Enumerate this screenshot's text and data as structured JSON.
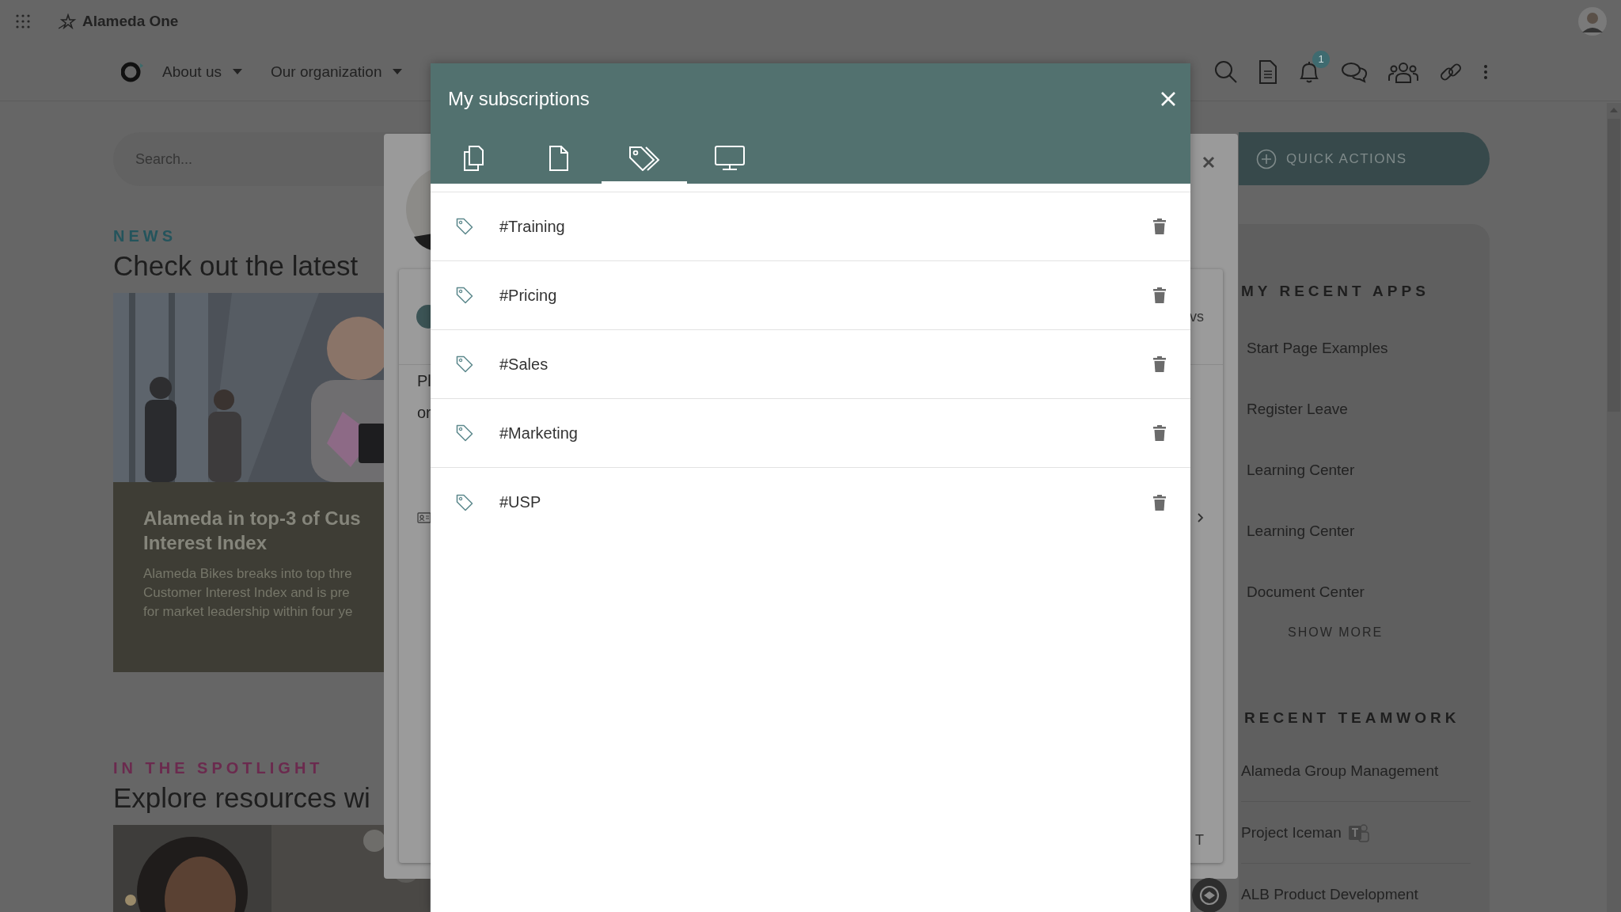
{
  "app_bar": {
    "title": "Alameda One"
  },
  "nav": {
    "items": [
      {
        "label": "About us"
      },
      {
        "label": "Our organization"
      }
    ],
    "notification_count": "1"
  },
  "search": {
    "placeholder": "Search..."
  },
  "quick_actions": {
    "label": "QUICK ACTIONS"
  },
  "news": {
    "eyebrow": "NEWS",
    "heading": "Check out the latest",
    "card": {
      "title_lines": [
        "Alameda in top-3 of Cus",
        "Interest Index"
      ],
      "text_lines": [
        "Alameda Bikes breaks into top thre",
        "Customer Interest Index and is pre",
        "for market leadership within four ye"
      ]
    }
  },
  "spotlight": {
    "eyebrow": "IN THE SPOTLIGHT",
    "heading": "Explore resources wi"
  },
  "recent_apps": {
    "title": "MY RECENT APPS",
    "items": [
      {
        "name": "Start Page Examples"
      },
      {
        "name": "Register Leave"
      },
      {
        "name": "Learning Center"
      },
      {
        "name": "Learning Center"
      },
      {
        "name": "Document Center"
      }
    ],
    "more": "SHOW MORE"
  },
  "recent_teamwork": {
    "title": "RECENT TEAMWORK",
    "items": [
      {
        "name": "Alameda Group Management",
        "kind": "plain"
      },
      {
        "name": "Project Iceman",
        "kind": "teams"
      },
      {
        "name": "ALB Product Development",
        "kind": "product"
      }
    ]
  },
  "background_dialog": {
    "header_text": "vs",
    "body_lines": [
      "Pl",
      "or"
    ],
    "footer_text": "T"
  },
  "dialog": {
    "title": "My subscriptions",
    "tabs": [
      {
        "kind": "copies",
        "selected": false
      },
      {
        "kind": "document",
        "selected": false
      },
      {
        "kind": "tags",
        "selected": true
      },
      {
        "kind": "screen",
        "selected": false
      }
    ],
    "subscriptions": [
      {
        "name": "#Training"
      },
      {
        "name": "#Pricing"
      },
      {
        "name": "#Sales"
      },
      {
        "name": "#Marketing"
      },
      {
        "name": "#USP"
      }
    ]
  }
}
